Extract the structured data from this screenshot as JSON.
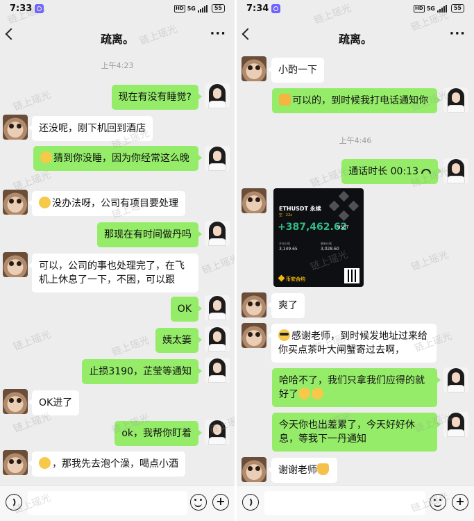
{
  "watermark": "链上瑶光",
  "left": {
    "status": {
      "time": "7:33",
      "net": "5G",
      "battery": "55",
      "hd": "HD"
    },
    "title": "疏离。",
    "timestamp": "上午4:23",
    "messages": [
      {
        "dir": "out",
        "text": "现在有没有睡觉?"
      },
      {
        "dir": "in",
        "text": "还没呢，刚下机回到酒店"
      },
      {
        "dir": "out",
        "emoji": "face-emoji",
        "text": "猜到你没睡，因为你经常这么晚"
      },
      {
        "dir": "in",
        "emoji": "face-emoji",
        "text": "没办法呀，公司有项目要处理"
      },
      {
        "dir": "out",
        "text": "那现在有时间做丹吗"
      },
      {
        "dir": "in",
        "text": "可以，公司的事也处理完了，在飞机上休息了一下，不困，可以跟"
      },
      {
        "dir": "out",
        "text": "OK"
      },
      {
        "dir": "out",
        "text": "姨太篓"
      },
      {
        "dir": "out",
        "text": "止损3190，芷莹等通知"
      },
      {
        "dir": "in",
        "text": "OK进了"
      },
      {
        "dir": "out",
        "text": "ok，我帮你盯着"
      },
      {
        "dir": "in",
        "emoji": "face-emoji",
        "text": "，那我先去泡个澡，喝点小酒"
      }
    ]
  },
  "right": {
    "status": {
      "time": "7:34",
      "net": "5G",
      "battery": "55",
      "hd": "HD"
    },
    "title": "疏离。",
    "timestamp": "上午4:46",
    "messages": [
      {
        "dir": "in",
        "text": "小酌一下"
      },
      {
        "dir": "out",
        "emoji": "thumbs-up-emoji",
        "text": "可以的，到时候我打电话通知你"
      },
      {
        "dir": "out",
        "text": "通话时长 00:13"
      },
      {
        "dir": "in",
        "image": true
      },
      {
        "dir": "in",
        "text": "爽了"
      },
      {
        "dir": "in",
        "emoji": "sunglasses-emoji",
        "text": "感谢老师，到时候发地址过来给你买点茶叶大闸蟹寄过去啊，"
      },
      {
        "dir": "out",
        "text": "哈哈不了，我们只拿我们应得的就好了",
        "trail_emoji": true
      },
      {
        "dir": "out",
        "text": "今天你也出差累了，今天好好休息，等我下一丹通知"
      },
      {
        "dir": "in",
        "text": "谢谢老师",
        "trail_emoji": true
      }
    ],
    "card": {
      "pair": "ETHUSDT 永续",
      "sub": "空 · 22x",
      "pnl": "+387,462.62",
      "unit": "USDT",
      "open_label": "开仓价格",
      "open_value": "3,149.65",
      "last_label": "最新价格",
      "last_value": "3,028.60",
      "brand": "币安合约"
    }
  }
}
